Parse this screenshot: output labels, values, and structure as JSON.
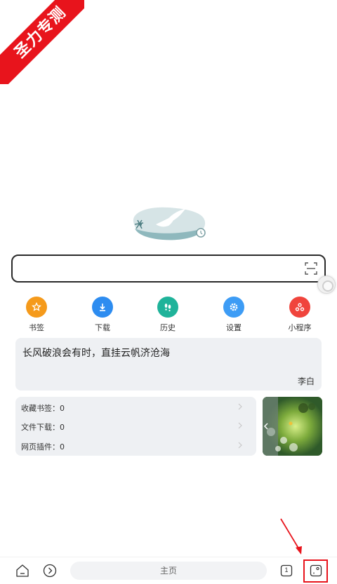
{
  "watermark": {
    "text": "圣力专测"
  },
  "search": {
    "value": "",
    "placeholder": ""
  },
  "quick_icons": [
    {
      "label": "书签",
      "icon": "star-icon",
      "color": "#f59a1b"
    },
    {
      "label": "下载",
      "icon": "download-icon",
      "color": "#2d8cf0"
    },
    {
      "label": "历史",
      "icon": "footprints-icon",
      "color": "#1fb39a"
    },
    {
      "label": "设置",
      "icon": "gear-icon",
      "color": "#3d9cf5"
    },
    {
      "label": "小程序",
      "icon": "mini-program-icon",
      "color": "#f0443c"
    }
  ],
  "quote": {
    "text": "长风破浪会有时，直挂云帆济沧海",
    "author": "李白"
  },
  "stats": [
    {
      "label": "收藏书签：0"
    },
    {
      "label": "文件下载：0"
    },
    {
      "label": "网页插件：0"
    }
  ],
  "bottom_bar": {
    "address_label": "主页",
    "tab_count": "1"
  },
  "colors": {
    "highlight": "#e8141c",
    "card_bg": "#eef0f3"
  }
}
